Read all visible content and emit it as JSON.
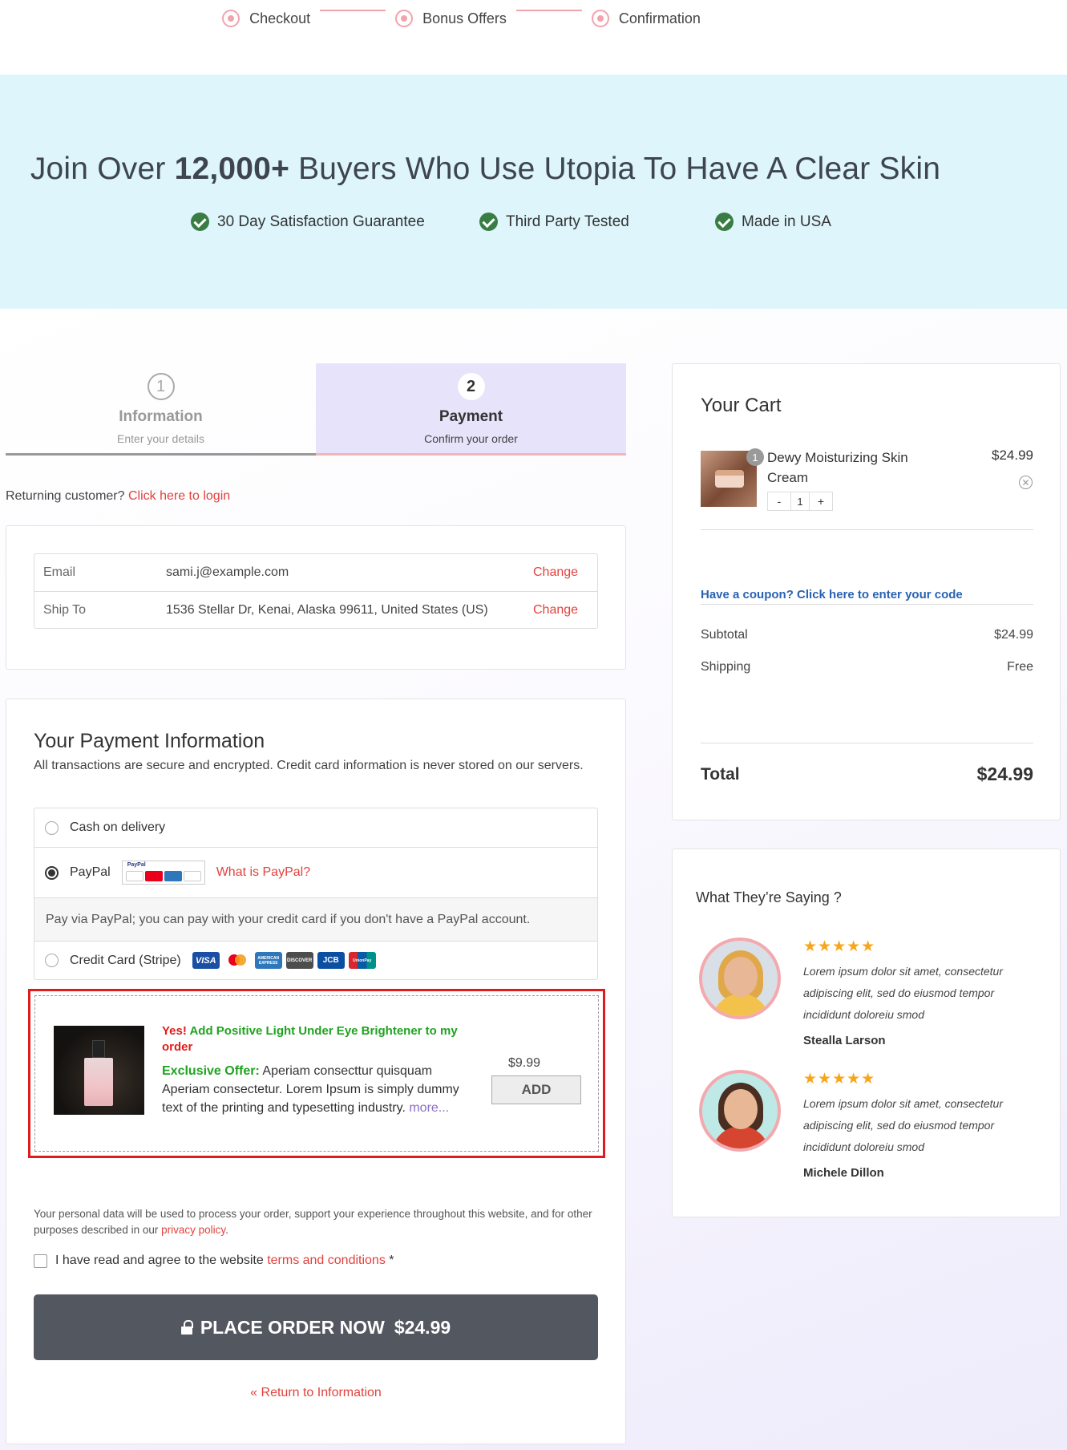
{
  "steps": [
    "Checkout",
    "Bonus Offers",
    "Confirmation"
  ],
  "hero": {
    "title_pre": "Join Over ",
    "title_bold": "12,000+",
    "title_post": " Buyers Who Use Utopia To Have A Clear Skin",
    "badges": [
      "30 Day Satisfaction Guarantee",
      "Third Party Tested",
      "Made in USA"
    ]
  },
  "tabs": [
    {
      "num": "1",
      "title": "Information",
      "sub": "Enter your details"
    },
    {
      "num": "2",
      "title": "Payment",
      "sub": "Confirm your order"
    }
  ],
  "returning": {
    "text": "Returning customer?",
    "link": "Click here to login"
  },
  "info": {
    "email_label": "Email",
    "email_value": "sami.j@example.com",
    "ship_label": "Ship To",
    "ship_value": "1536 Stellar Dr, Kenai, Alaska 99611, United States (US)",
    "change": "Change"
  },
  "payment": {
    "title": "Your Payment Information",
    "desc": "All transactions are secure and encrypted. Credit card information is never stored on our servers.",
    "cod": "Cash on delivery",
    "paypal": "PayPal",
    "paypal_logo_text": "PayPal",
    "what_paypal": "What is PayPal?",
    "paypal_desc": "Pay via PayPal; you can pay with your credit card if you don't have a PayPal account.",
    "stripe": "Credit Card (Stripe)",
    "selected": "PayPal",
    "card_logos": [
      "VISA",
      "mastercard",
      "AMERICAN EXPRESS",
      "DISCOVER",
      "JCB",
      "UnionPay"
    ]
  },
  "bump": {
    "yes": "Yes!",
    "head_green": " Add Positive Light Under Eye Brightener to my",
    "head_red": "order",
    "offer_label": "Exclusive Offer:",
    "offer_text": " Aperiam consecttur quisquam Aperiam consectetur. Lorem Ipsum is simply dummy text of the printing and typesetting industry.",
    "more": "more...",
    "price": "$9.99",
    "add": "ADD"
  },
  "privacy": {
    "text": "Your personal data will be used to process your order, support your experience throughout this website, and for other purposes described in our ",
    "link": "privacy policy",
    "end": "."
  },
  "terms": {
    "text": "I have read and agree to the website ",
    "link": "terms and conditions",
    "req": " *"
  },
  "place_order": {
    "label": "PLACE ORDER NOW",
    "amount": "$24.99"
  },
  "return_link": "« Return to Information",
  "cart": {
    "title": "Your Cart",
    "item_name": "Dewy Moisturizing Skin Cream",
    "item_price": "$24.99",
    "qty": "1",
    "minus": "-",
    "plus": "+",
    "coupon": "Have a coupon? Click here to enter your code",
    "subtotal_label": "Subtotal",
    "subtotal": "$24.99",
    "shipping_label": "Shipping",
    "shipping": "Free",
    "total_label": "Total",
    "total": "$24.99"
  },
  "reviews": {
    "title": "What They’re Saying ?",
    "stars": "★★★★★",
    "items": [
      {
        "text": "Lorem ipsum dolor sit amet, consectetur adipiscing elit, sed do eiusmod tempor incididunt doloreiu smod",
        "name": "Stealla Larson"
      },
      {
        "text": "Lorem ipsum dolor sit amet, consectetur adipiscing elit, sed do eiusmod tempor incididunt doloreiu smod",
        "name": "Michele Dillon"
      }
    ]
  },
  "colors": {
    "accent_red": "#e2423d",
    "hero_bg": "#ddf5fb",
    "button_dark": "#53575f",
    "green": "#3a7d44",
    "link_blue": "#2862b3"
  }
}
